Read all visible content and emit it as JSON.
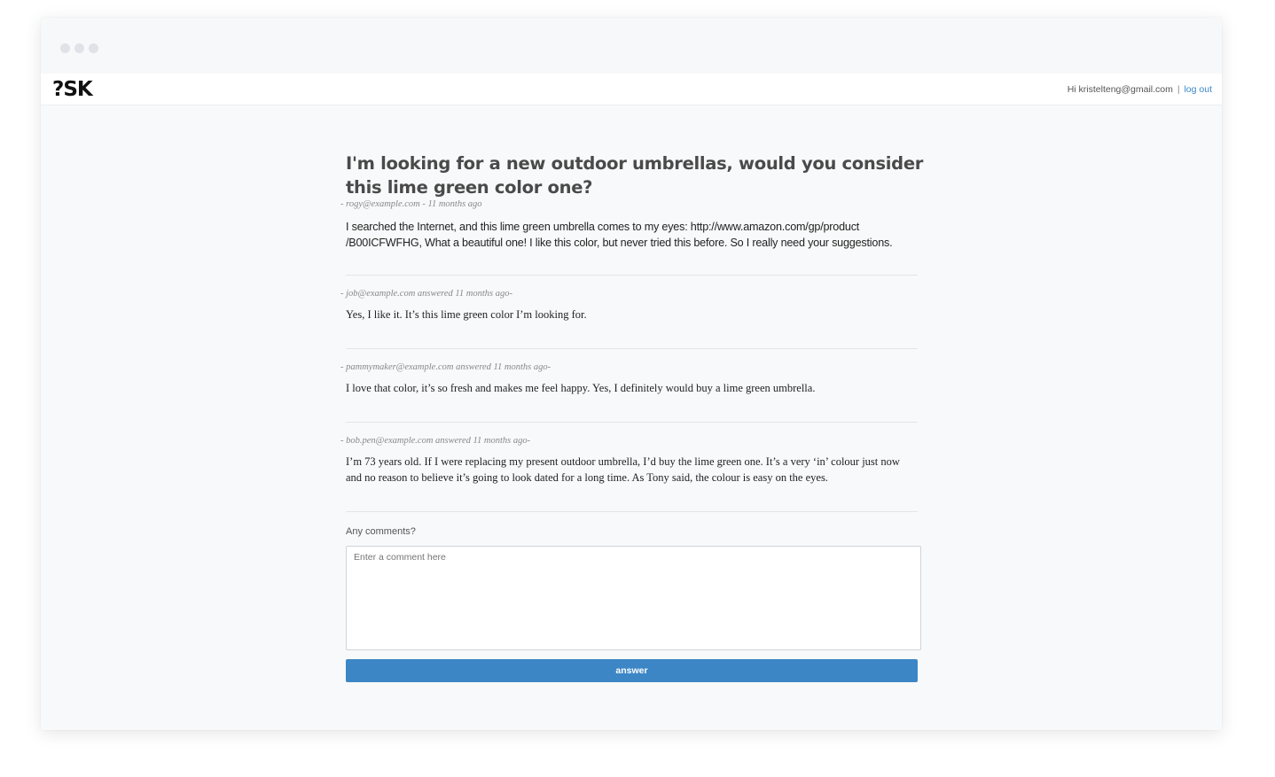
{
  "app": {
    "logo": "?SK"
  },
  "header": {
    "greeting": "Hi kristelteng@gmail.com",
    "separator": "|",
    "logout_label": "log out"
  },
  "question": {
    "title": "I'm looking for a new outdoor umbrellas, would you consider this lime green color one?",
    "meta": "- rogy@example.com - 11 months ago",
    "body_line1": "I searched the Internet, and this lime green umbrella comes to my eyes: http://www.amazon.com/gp/product",
    "body_line2": "/B00ICFWFHG, What a beautiful one! I like this color, but never tried this before. So I really need your suggestions."
  },
  "answers": [
    {
      "meta": "- job@example.com answered 11 months ago-",
      "text_line1": "Yes, I like it. It’s this lime green color I’m looking for.",
      "text_line2": ""
    },
    {
      "meta": "- pammymaker@example.com answered 11 months ago-",
      "text_line1": "I love that color, it’s so fresh and makes me feel happy. Yes, I definitely would buy a lime green umbrella.",
      "text_line2": ""
    },
    {
      "meta": "- bob.pen@example.com answered 11 months ago-",
      "text_line1": "I’m 73 years old. If I were replacing my present outdoor umbrella, I’d buy the lime green one. It’s a very ‘in’ colour just now",
      "text_line2": "and no reason to believe it’s going to look dated for a long time. As Tony said, the colour is easy on the eyes."
    }
  ],
  "comment_form": {
    "label": "Any comments?",
    "placeholder": "Enter a comment here",
    "submit_label": "answer"
  },
  "colors": {
    "accent": "#3d86c6",
    "link": "#3b87c8",
    "background": "#f8f9fa"
  }
}
